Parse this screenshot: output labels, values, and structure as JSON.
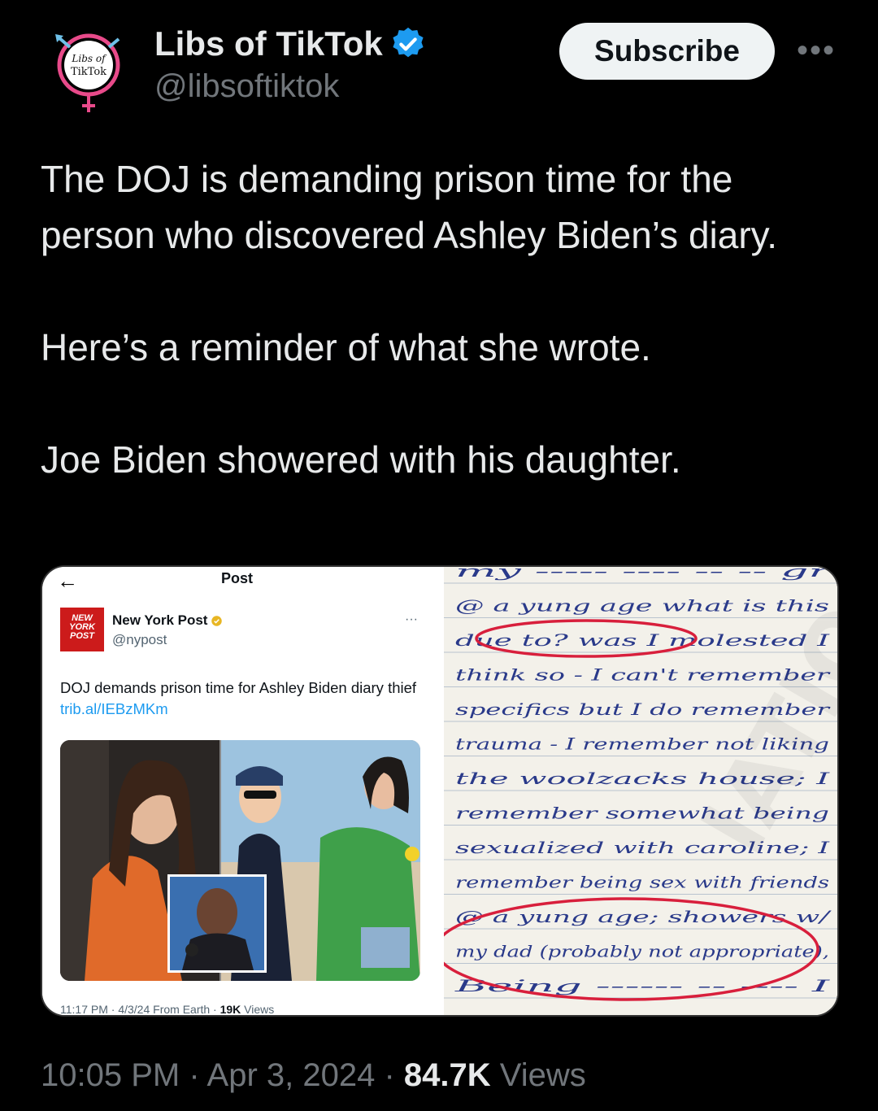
{
  "author": {
    "name": "Libs of TikTok",
    "handle": "@libsoftiktok",
    "avatar_text": "Libs of TikTok",
    "verified_color": "#1d9bf0"
  },
  "actions": {
    "subscribe_label": "Subscribe",
    "more_label": "•••"
  },
  "tweet": {
    "paragraphs": [
      "The DOJ is demanding prison time for the person who discovered Ashley Biden’s diary.",
      "Here’s a reminder of what she wrote.",
      "Joe Biden showered with his daughter."
    ]
  },
  "embedded_post": {
    "header_title": "Post",
    "account_name": "New York Post",
    "account_handle": "@nypost",
    "logo_text": "NEW YORK POST",
    "text": "DOJ demands prison time for Ashley Biden diary thief ",
    "link": "trib.al/IEBzMKm",
    "meta_prefix": "11:17 PM · 4/3/24 From Earth · ",
    "meta_views": "19K",
    "meta_suffix": " Views"
  },
  "diary": {
    "lines": [
      "my ----- ---- -- -- gr",
      "@ a yung age what is this",
      "due to? was I molested I",
      "think so - I can't remember",
      "specifics but I do remember",
      "trauma - I remember not liking",
      "the woolzacks house; I",
      "remember somewhat being",
      "sexualized with caroline; I",
      "remember being sex with friends",
      "@ a yung age; showers w/",
      "my dad (probably not appropriate),",
      "Being ------ -- ---- I"
    ]
  },
  "footer": {
    "time": "10:05 PM · Apr 3, 2024 · ",
    "views_count": "84.7K",
    "views_label": " Views"
  },
  "colors": {
    "background": "#000000",
    "text": "#e7e9ea",
    "secondary": "#71767b",
    "accent": "#1d9bf0",
    "ink": "#2a3a8a",
    "circle": "#d81f3c"
  }
}
